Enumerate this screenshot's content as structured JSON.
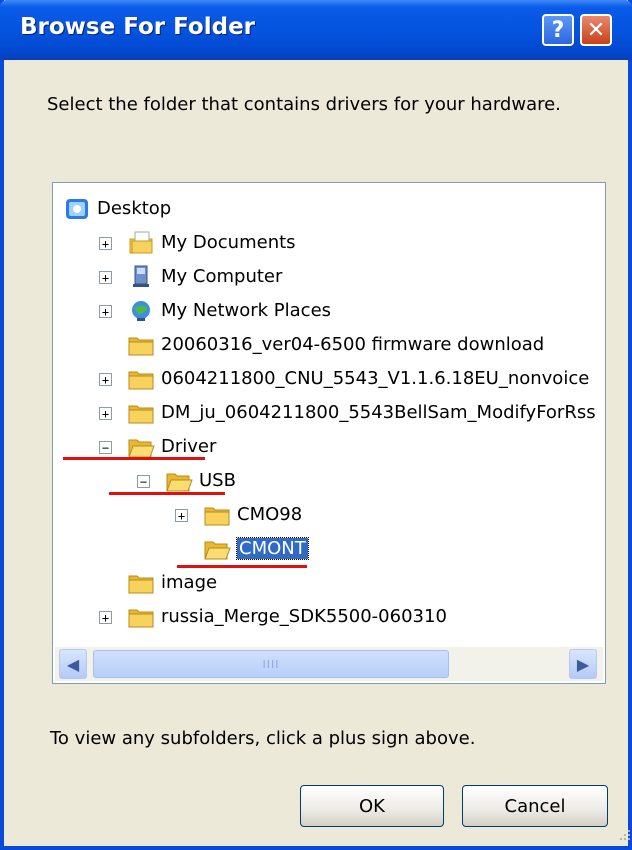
{
  "window": {
    "title": "Browse For Folder",
    "help_label": "?",
    "close_label": "✕"
  },
  "instruction": "Select the folder that contains drivers for your hardware.",
  "tree": {
    "items": [
      {
        "label": "Desktop",
        "icon": "desktop-icon",
        "expander": ""
      },
      {
        "label": "My Documents",
        "icon": "my-documents-icon",
        "expander": "+"
      },
      {
        "label": "My Computer",
        "icon": "my-computer-icon",
        "expander": "+"
      },
      {
        "label": "My Network Places",
        "icon": "network-places-icon",
        "expander": "+"
      },
      {
        "label": "20060316_ver04-6500 firmware download",
        "icon": "folder-icon",
        "expander": ""
      },
      {
        "label": "0604211800_CNU_5543_V1.1.6.18EU_nonvoice",
        "icon": "folder-icon",
        "expander": "+"
      },
      {
        "label": "DM_ju_0604211800_5543BellSam_ModifyForRss",
        "icon": "folder-icon",
        "expander": "+"
      },
      {
        "label": "Driver",
        "icon": "folder-open-icon",
        "expander": "−"
      },
      {
        "label": "USB",
        "icon": "folder-open-icon",
        "expander": "−"
      },
      {
        "label": "CMO98",
        "icon": "folder-icon",
        "expander": "+"
      },
      {
        "label": "CMONT",
        "icon": "folder-open-icon",
        "expander": "",
        "selected": true
      },
      {
        "label": "image",
        "icon": "folder-icon",
        "expander": ""
      },
      {
        "label": "russia_Merge_SDK5500-060310",
        "icon": "folder-icon",
        "expander": "+"
      }
    ],
    "scrollbar": {
      "left_arrow": "◀",
      "right_arrow": "▶",
      "thumb_grip": "IIII"
    }
  },
  "hint": "To view any subfolders, click a plus sign above.",
  "buttons": {
    "ok": "OK",
    "cancel": "Cancel"
  },
  "colors": {
    "title_bar": "#0554e0",
    "dialog_bg": "#ece9d8",
    "selection": "#316ac5",
    "annotation_underline": "#e01010",
    "folder": "#f5c945"
  }
}
